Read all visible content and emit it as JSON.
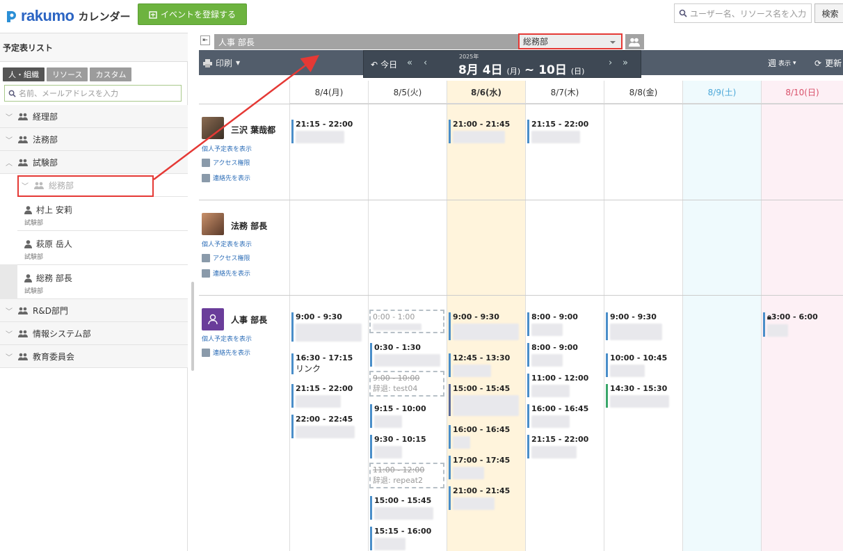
{
  "header": {
    "brand": "rakumo",
    "product": "カレンダー",
    "add_event": "イベントを登録する",
    "search_placeholder": "ユーザー名、リソース名を入力",
    "search_button": "検索"
  },
  "sidebar": {
    "title": "予定表リスト",
    "tabs": [
      "人・組織",
      "リソース",
      "カスタム"
    ],
    "search_placeholder": "名前、メールアドレスを入力",
    "groups": {
      "keiri": "経理部",
      "houmu": "法務部",
      "shiken": "試験部",
      "soumu_sub": "総務部",
      "rnd": "R&D部門",
      "jouhou": "情報システム部",
      "kyouiku": "教育委員会"
    },
    "members": [
      {
        "name": "村上 安莉",
        "dept": "試験部"
      },
      {
        "name": "萩原 岳人",
        "dept": "試験部"
      },
      {
        "name": "総務 部長",
        "dept": "試験部"
      }
    ]
  },
  "viewbar": {
    "current_name": "人事 部長",
    "selected_group": "総務部"
  },
  "navbar": {
    "print": "印刷",
    "today": "今日",
    "year": "2025年",
    "month1": "8",
    "m": "月",
    "day1": "4",
    "d": "日",
    "dow1": "(月)",
    "tilde": "~",
    "day2": "10",
    "dow2": "(日)",
    "week": "週",
    "week_suffix": "表示",
    "refresh": "更新"
  },
  "days": [
    "8/4(月)",
    "8/5(火)",
    "8/6(水)",
    "8/7(木)",
    "8/8(金)",
    "8/9(土)",
    "8/10(日)"
  ],
  "colors": {
    "today_bg": "#fff4dc",
    "sat_bg": "#effafd",
    "sun_bg": "#fdf0f5",
    "sat_text": "#4aa7d8",
    "sun_text": "#d9506a",
    "accent_red": "#e53935",
    "green_btn": "#6db33f"
  },
  "people": [
    {
      "name": "三沢 葉哉都",
      "link_schedule": "個人予定表を表示",
      "link_access": "アクセス権限",
      "link_contact": "連絡先を表示"
    },
    {
      "name": "法務 部長",
      "link_schedule": "個人予定表を表示",
      "link_access": "アクセス権限",
      "link_contact": "連絡先を表示"
    },
    {
      "name": "人事 部長",
      "link_schedule": "個人予定表を表示",
      "link_contact": "連絡先を表示"
    }
  ],
  "events": {
    "p1": [
      "21:15 - 22:00",
      "21:00 - 21:45",
      "21:15 - 22:00"
    ],
    "p3_mon": [
      "9:00 - 9:30",
      "16:30 - 17:15",
      "リンク",
      "21:15 - 22:00",
      "22:00 - 22:45"
    ],
    "p3_tue": [
      "0:00 - 1:00",
      "0:30 - 1:30",
      "9:00 - 10:00",
      "辞退: test04",
      "9:15 - 10:00",
      "9:30 - 10:15",
      "11:00 - 12:00",
      "辞退: repeat2",
      "15:00 - 15:45",
      "15:15 - 16:00"
    ],
    "p3_wed": [
      "9:00 - 9:30",
      "12:45 - 13:30",
      "15:00 - 15:45",
      "16:00 - 16:45",
      "17:00 - 17:45",
      "21:00 - 21:45"
    ],
    "p3_thu": [
      "8:00 - 9:00",
      "8:00 - 9:00",
      "11:00 - 12:00",
      "16:00 - 16:45",
      "21:15 - 22:00"
    ],
    "p3_fri": [
      "9:00 - 9:30",
      "10:00 - 10:45",
      "14:30 - 15:30"
    ],
    "p3_sun": [
      "3:00 - 6:00"
    ]
  }
}
